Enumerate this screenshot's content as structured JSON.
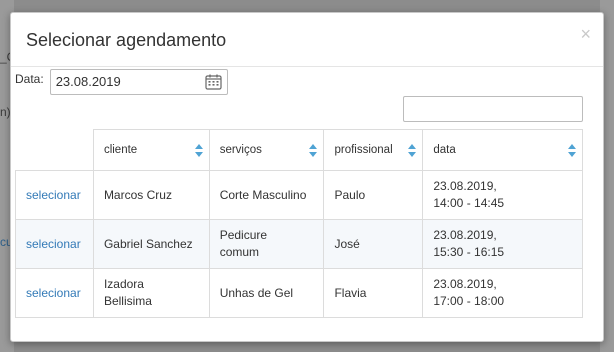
{
  "background": {
    "fragments": [
      "_C",
      "n)",
      "cu"
    ]
  },
  "modal": {
    "title": "Selecionar agendamento",
    "close_glyph": "×",
    "date": {
      "label": "Data:",
      "value": "23.08.2019"
    },
    "search": {
      "value": ""
    },
    "table": {
      "columns": [
        "cliente",
        "serviços",
        "profissional",
        "data"
      ],
      "rows": [
        {
          "action": "selecionar",
          "cliente": "Marcos Cruz",
          "servicos": "Corte Masculino",
          "profissional": "Paulo",
          "data_line1": "23.08.2019,",
          "data_line2": "14:00 - 14:45"
        },
        {
          "action": "selecionar",
          "cliente": "Gabriel Sanchez",
          "servicos_line1": "Pedicure",
          "servicos_line2": "comum",
          "profissional": "José",
          "data_line1": "23.08.2019,",
          "data_line2": "15:30 - 16:15"
        },
        {
          "action": "selecionar",
          "cliente_line1": "Izadora",
          "cliente_line2": "Bellisima",
          "servicos": "Unhas de Gel",
          "profissional": "Flavia",
          "data_line1": "23.08.2019,",
          "data_line2": "17:00 - 18:00"
        }
      ]
    },
    "icons": {
      "calendar": "calendar-icon",
      "sort": "sort-both-icon",
      "accent_color": "#4fa3d4",
      "link_color": "#337ab7"
    }
  }
}
